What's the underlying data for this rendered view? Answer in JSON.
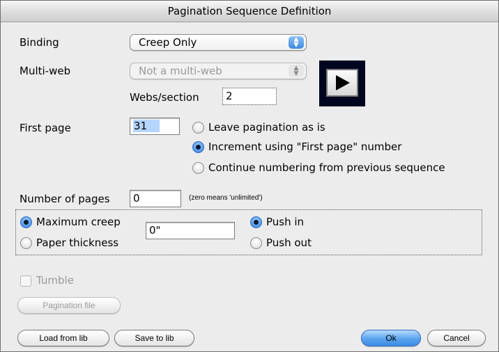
{
  "dialog": {
    "title": "Pagination Sequence Definition"
  },
  "binding": {
    "label": "Binding",
    "value": "Creep Only"
  },
  "multiweb": {
    "label": "Multi-web",
    "value": "Not a multi-web"
  },
  "webs_section": {
    "label": "Webs/section",
    "value": "2"
  },
  "play_button": {
    "icon": "play-icon"
  },
  "first_page": {
    "label": "First page",
    "value": "31",
    "options": [
      {
        "label": "Leave pagination as is",
        "selected": false
      },
      {
        "label": "Increment using \"First page\" number",
        "selected": true
      },
      {
        "label": "Continue numbering from previous sequence",
        "selected": false
      }
    ]
  },
  "num_pages": {
    "label": "Number of pages",
    "value": "0",
    "note": "(zero means 'unlimited')"
  },
  "creep": {
    "max_creep_label": "Maximum creep",
    "paper_thickness_label": "Paper thickness",
    "mode_selected": "Maximum creep",
    "value": "0\"",
    "push_in_label": "Push in",
    "push_out_label": "Push out",
    "push_selected": "Push in"
  },
  "tumble": {
    "label": "Tumble",
    "checked": false,
    "enabled": false
  },
  "buttons": {
    "pagination_file": "Pagination file",
    "load_from_lib": "Load from lib",
    "save_to_lib": "Save to lib",
    "ok": "Ok",
    "cancel": "Cancel"
  },
  "colors": {
    "accent": "#3d8be3",
    "selection": "#b5d5ff",
    "play_bg": "#000520"
  }
}
